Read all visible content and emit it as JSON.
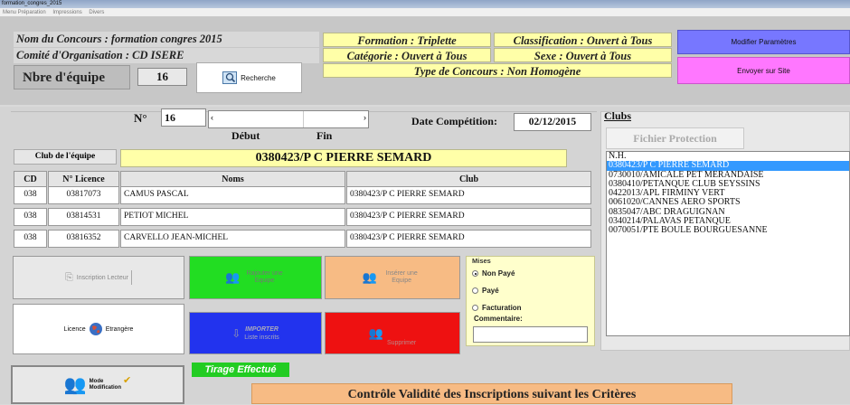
{
  "window": {
    "title": "formation_congres_2015",
    "menu": [
      "Menu Préparation",
      "Impressions",
      "Divers"
    ]
  },
  "header": {
    "concours": "Nom du Concours : formation congres  2015",
    "comite": "Comité d'Organisation : CD ISERE",
    "formation": "Formation : Triplette",
    "categorie": "Catégorie : Ouvert à Tous",
    "classification": "Classification : Ouvert à Tous",
    "sexe": "Sexe : Ouvert à Tous",
    "type_concours": "Type de Concours : Non Homogène",
    "nbre_label": "Nbre d'équipe",
    "nbre_value": "16",
    "recherche": "Recherche",
    "modifier": "Modifier Paramètres",
    "envoyer": "Envoyer sur Site"
  },
  "team": {
    "no_label": "N°",
    "no_value": "16",
    "debut": "Début",
    "fin": "Fin",
    "date_label": "Date Compétition:",
    "date_value": "02/12/2015",
    "club_label": "Club de l'équipe",
    "club_value": "0380423/P C PIERRE SEMARD"
  },
  "table": {
    "headers": [
      "CD",
      "N° Licence",
      "Noms",
      "Club"
    ],
    "rows": [
      [
        "038",
        "03817073",
        "CAMUS PASCAL",
        "0380423/P C PIERRE SEMARD"
      ],
      [
        "038",
        "03814531",
        "PETIOT MICHEL",
        "0380423/P C PIERRE SEMARD"
      ],
      [
        "038",
        "03816352",
        "CARVELLO JEAN-MICHEL",
        "0380423/P C PIERRE SEMARD"
      ]
    ]
  },
  "actions": {
    "inscription_lecteur": "Inscription Lecteur",
    "rajouter": "Rajouter une Equipe",
    "inserer": "Insérer une Equipe",
    "licence": "Licence",
    "etrangere": "Etrangère",
    "importer": "IMPORTER",
    "liste_inscrits": "Liste inscrits",
    "supprimer": "Supprimer",
    "mode": "Mode",
    "modification": "Modification",
    "tirage": "Tirage Effectué",
    "controle": "Contrôle Validité des Inscriptions suivant les Critères"
  },
  "mises": {
    "title": "Mises",
    "options": [
      "Non Payé",
      "Payé",
      "Facturation"
    ],
    "selected": "Non Payé",
    "commentaire_label": "Commentaire:",
    "commentaire_value": ""
  },
  "clubs": {
    "title": "Clubs",
    "fichier": "Fichier Protection",
    "items": [
      "N.H.",
      "0380423/P C PIERRE SEMARD",
      "0730010/AMICALE PET MERANDAISE",
      "0380410/PETANQUE CLUB SEYSSINS",
      "0422013/APL FIRMINY VERT",
      "0061020/CANNES AERO SPORTS",
      "0835047/ABC DRAGUIGNAN",
      "0340214/PALAVAS PETANQUE",
      "0070051/PTE BOULE BOURGUESANNE"
    ],
    "selected_index": 1
  },
  "colors": {
    "yellow": "#ffffa8",
    "green": "#22dd22",
    "orange": "#f7bb84",
    "blue": "#2233ee",
    "red": "#ee1111",
    "modifier": "#7777ff",
    "envoyer": "#ff77ff"
  }
}
